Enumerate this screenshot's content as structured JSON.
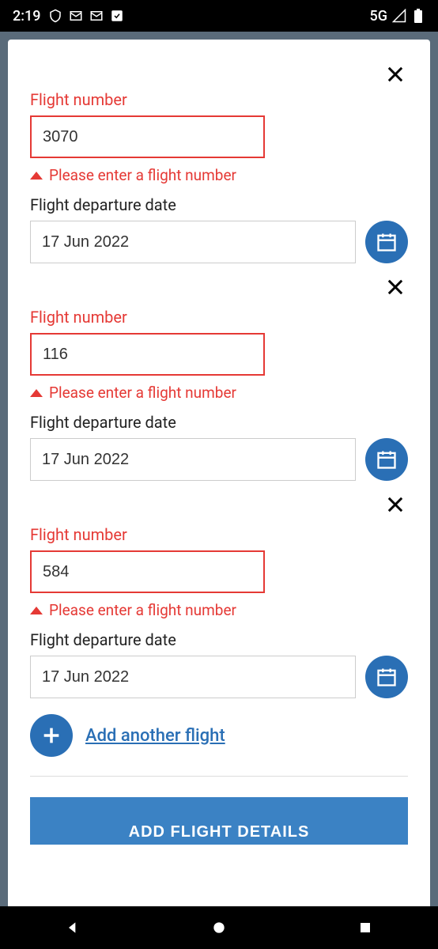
{
  "statusBar": {
    "time": "2:19",
    "network": "5G"
  },
  "flights": [
    {
      "numberLabel": "Flight number",
      "numberValue": "3070",
      "errorMsg": "Please enter a flight number",
      "dateLabel": "Flight departure date",
      "dateValue": "17 Jun 2022"
    },
    {
      "numberLabel": "Flight number",
      "numberValue": "116",
      "errorMsg": "Please enter a flight number",
      "dateLabel": "Flight departure date",
      "dateValue": "17 Jun 2022"
    },
    {
      "numberLabel": "Flight number",
      "numberValue": "584",
      "errorMsg": "Please enter a flight number",
      "dateLabel": "Flight departure date",
      "dateValue": "17 Jun 2022"
    }
  ],
  "addFlightLabel": "Add another flight",
  "submitLabel": "ADD FLIGHT DETAILS"
}
